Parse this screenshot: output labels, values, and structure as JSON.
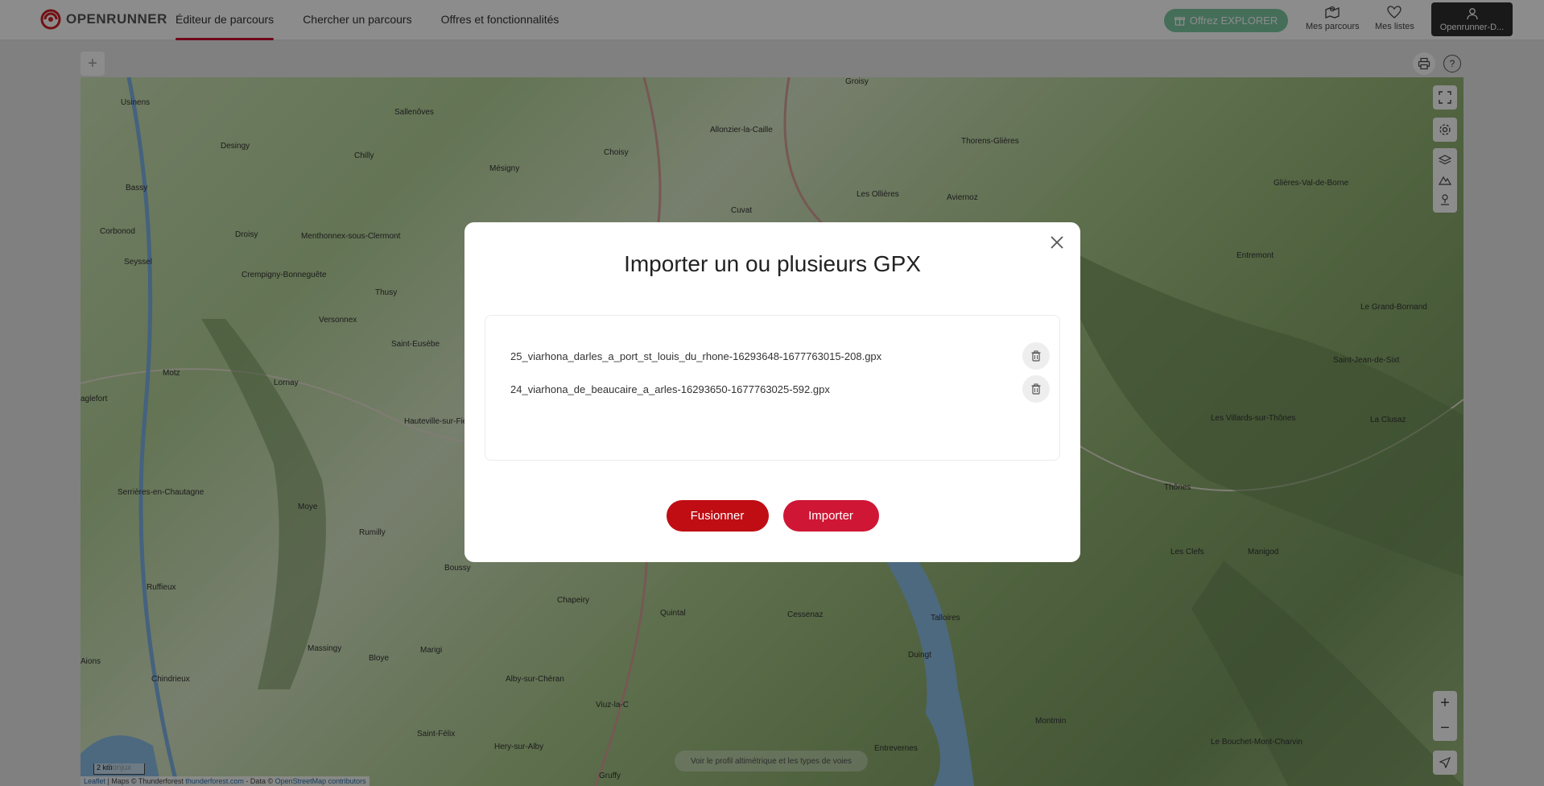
{
  "header": {
    "logo_text": "OPENRUNNER",
    "nav": [
      {
        "label": "Éditeur de parcours",
        "active": true
      },
      {
        "label": "Chercher un parcours",
        "active": false
      },
      {
        "label": "Offres et fonctionnalités",
        "active": false
      }
    ],
    "offer_button": "Offrez EXPLORER",
    "my_routes": "Mes parcours",
    "my_lists": "Mes listes",
    "user_label": "Openrunner-D..."
  },
  "map": {
    "labels": [
      "Usinens",
      "Sallenôves",
      "Allonzier-la-Caille",
      "Groisy",
      "Thorens-Glières",
      "Desingy",
      "Chilly",
      "Choisy",
      "Mésigny",
      "Bassy",
      "Corbonod",
      "Droisy",
      "Menthonnex-sous-Clermont",
      "Cuvat",
      "Les Ollières",
      "Aviernoz",
      "Glières-Val-de-Borne",
      "Seyssel",
      "Crempigny-Bonneguête",
      "Thusy",
      "Entremont",
      "Versonnex",
      "Saint-Eusèbe",
      "Le Grand-Bornand",
      "Motz",
      "Lornay",
      "Saint-Jean-de-Sixt",
      "Hauteville-sur-Fier",
      "Les Villards-sur-Thônes",
      "La Clusaz",
      "Serrières-en-Chautagne",
      "Moye",
      "Thônes",
      "Rumilly",
      "Boussy",
      "Les Clefs",
      "Manigod",
      "Ruffieux",
      "Chapeiry",
      "Quintal",
      "Cessenaz",
      "Talloires",
      "Massingy",
      "Bloye",
      "Marigi",
      "Duingt",
      "Chindrieux",
      "Alby-sur-Chéran",
      "Viuz-la-C",
      "Montmin",
      "Saint-Félix",
      "Hery-sur-Alby",
      "Entrevernes",
      "Le Bouchet-Mont-Charvin",
      "Conjux",
      "Gruffy",
      "aglefort",
      "Aions"
    ],
    "scale": "2 km",
    "attribution_leaflet": "Leaflet",
    "attribution_text": " | Maps © Thunderforest ",
    "attribution_tf": "thunderforest.com",
    "attribution_data": " - Data © ",
    "attribution_osm": "OpenStreetMap contributors",
    "bottom_hint": "Voir le profil altimétrique et les types de voies",
    "zoom_in": "+",
    "zoom_out": "−",
    "help": "?"
  },
  "modal": {
    "title": "Importer un ou plusieurs GPX",
    "files": [
      "25_viarhona_darles_a_port_st_louis_du_rhone-16293648-1677763015-208.gpx",
      "24_viarhona_de_beaucaire_a_arles-16293650-1677763025-592.gpx"
    ],
    "merge_button": "Fusionner",
    "import_button": "Importer"
  },
  "colors": {
    "brand_red": "#c8102e",
    "merge_red": "#c00d14",
    "import_red": "#cf1735",
    "offer_green": "#7ec9a2"
  }
}
